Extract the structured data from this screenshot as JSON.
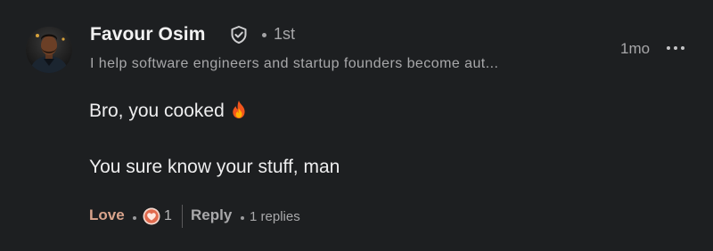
{
  "author": {
    "name": "Favour Osim",
    "connection_degree": "1st",
    "headline": "I help software engineers and startup founders become aut...",
    "avatar_icon": "profile-photo",
    "verified_icon": "verified-shield-icon"
  },
  "comment": {
    "timestamp": "1mo",
    "line1": "Bro, you cooked",
    "line1_emoji": "fire-icon",
    "line2": "You sure know your stuff, man"
  },
  "actions": {
    "love_label": "Love",
    "reaction_icon": "heart-reaction-icon",
    "reaction_count": "1",
    "reply_label": "Reply",
    "replies_text": "1 replies"
  },
  "colors": {
    "background": "#1d1f21",
    "love_accent": "#d9a48c",
    "reaction_badge": "#e06a4e"
  }
}
